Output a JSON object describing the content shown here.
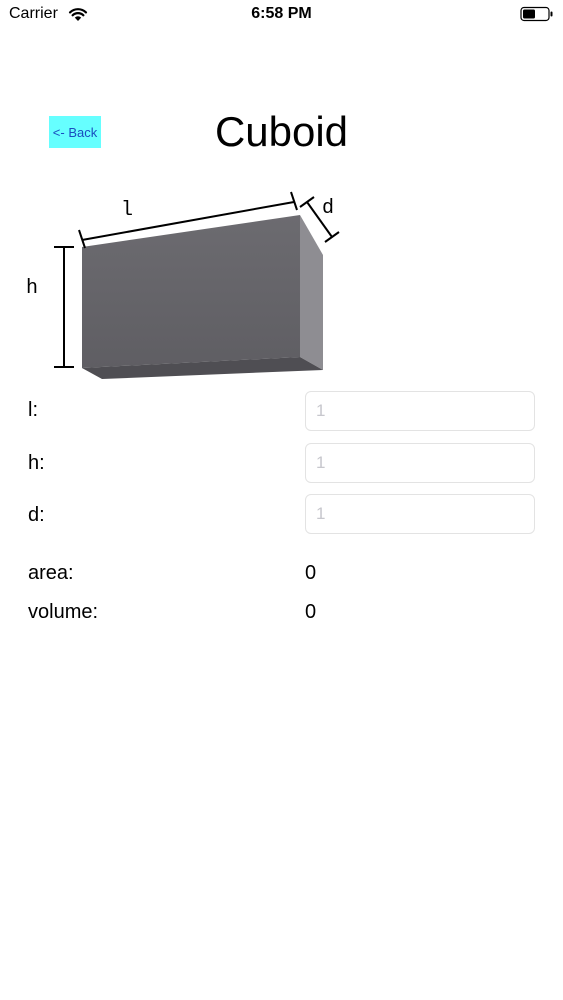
{
  "status_bar": {
    "carrier": "Carrier",
    "time": "6:58 PM"
  },
  "header": {
    "back_label": "<- Back",
    "title": "Cuboid",
    "back_color": "#66ffff"
  },
  "diagram": {
    "label_l": "l",
    "label_h": "h",
    "label_d": "d"
  },
  "fields": [
    {
      "label": "l:",
      "placeholder": "1",
      "value": ""
    },
    {
      "label": "h:",
      "placeholder": "1",
      "value": ""
    },
    {
      "label": "d:",
      "placeholder": "1",
      "value": ""
    }
  ],
  "results": {
    "area_label": "area:",
    "area_value": "0",
    "volume_label": "volume:",
    "volume_value": "0"
  }
}
